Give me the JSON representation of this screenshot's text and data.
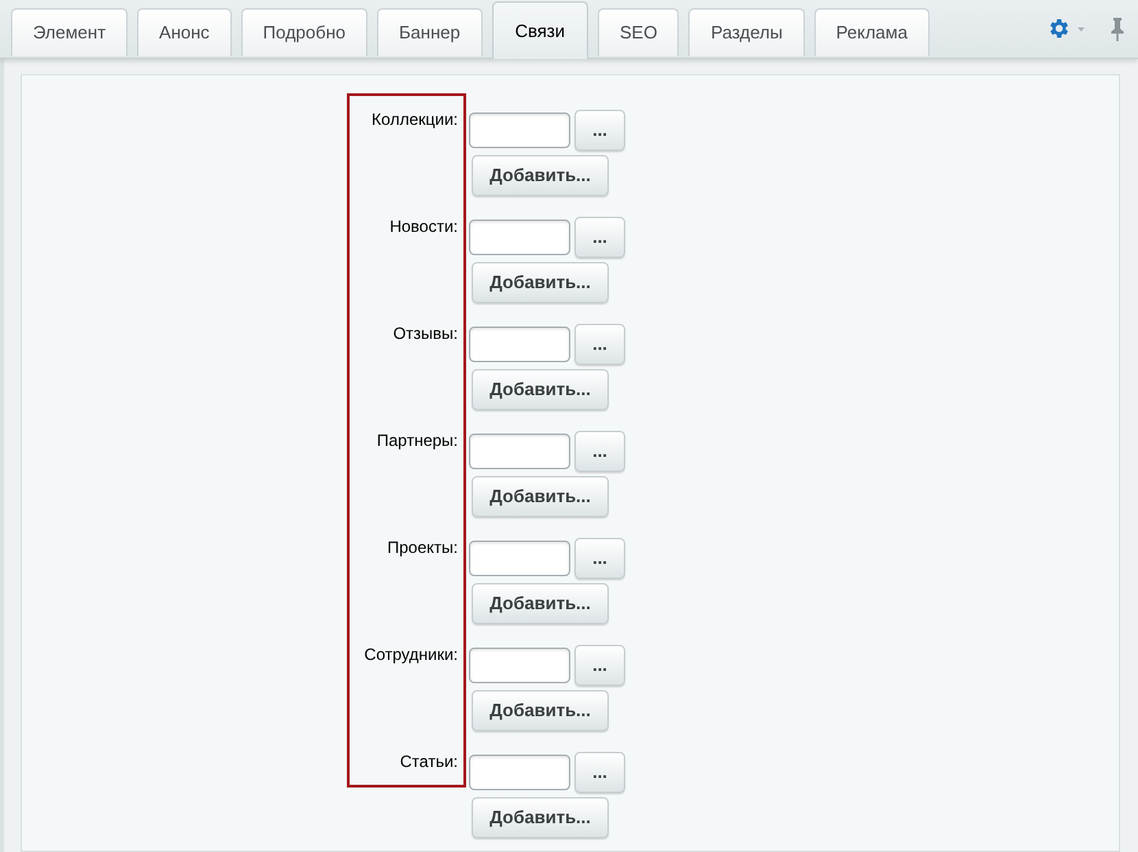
{
  "tabs": [
    {
      "label": "Элемент",
      "selected": false
    },
    {
      "label": "Анонс",
      "selected": false
    },
    {
      "label": "Подробно",
      "selected": false
    },
    {
      "label": "Баннер",
      "selected": false
    },
    {
      "label": "Связи",
      "selected": true
    },
    {
      "label": "SEO",
      "selected": false
    },
    {
      "label": "Разделы",
      "selected": false
    },
    {
      "label": "Реклама",
      "selected": false
    }
  ],
  "form": {
    "labels_highlighted": true,
    "fields": [
      {
        "label": "Коллекции:",
        "browse_button": "...",
        "add_button": "Добавить..."
      },
      {
        "label": "Новости:",
        "browse_button": "...",
        "add_button": "Добавить..."
      },
      {
        "label": "Отзывы:",
        "browse_button": "...",
        "add_button": "Добавить..."
      },
      {
        "label": "Партнеры:",
        "browse_button": "...",
        "add_button": "Добавить..."
      },
      {
        "label": "Проекты:",
        "browse_button": "...",
        "add_button": "Добавить..."
      },
      {
        "label": "Сотрудники:",
        "browse_button": "...",
        "add_button": "Добавить..."
      },
      {
        "label": "Статьи:",
        "browse_button": "...",
        "add_button": "Добавить..."
      }
    ]
  }
}
